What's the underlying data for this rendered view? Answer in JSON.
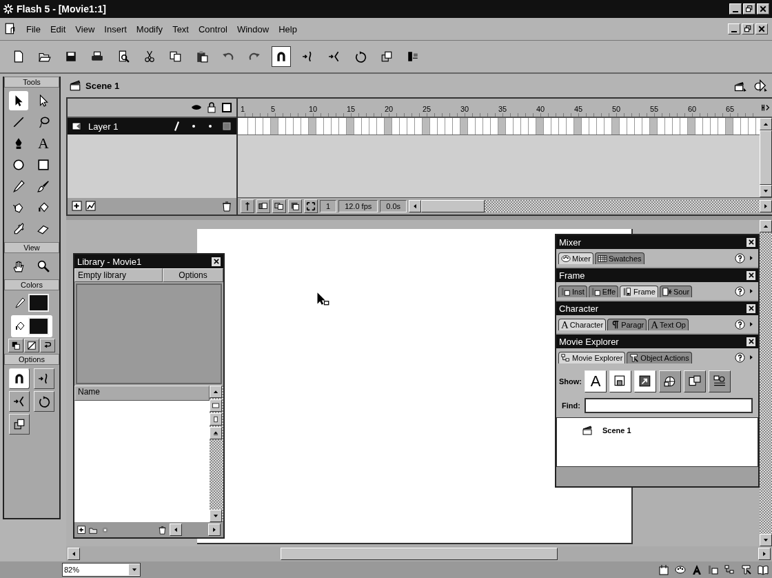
{
  "window": {
    "title": "Flash 5 - [Movie1:1]"
  },
  "menu": [
    "File",
    "Edit",
    "View",
    "Insert",
    "Modify",
    "Text",
    "Control",
    "Window",
    "Help"
  ],
  "toolbar": [
    {
      "kind": "new",
      "selected": false
    },
    {
      "kind": "open",
      "selected": false
    },
    {
      "kind": "save",
      "selected": false
    },
    {
      "kind": "print",
      "selected": false
    },
    {
      "kind": "preview",
      "selected": false
    },
    {
      "kind": "cut",
      "selected": false
    },
    {
      "kind": "copy",
      "selected": false
    },
    {
      "kind": "paste",
      "selected": false
    },
    {
      "kind": "undo",
      "selected": false
    },
    {
      "kind": "redo",
      "selected": false
    },
    {
      "kind": "snap",
      "selected": true
    },
    {
      "kind": "smooth",
      "selected": false
    },
    {
      "kind": "straighten",
      "selected": false
    },
    {
      "kind": "rotate",
      "selected": false
    },
    {
      "kind": "scale",
      "selected": false
    },
    {
      "kind": "align",
      "selected": false
    }
  ],
  "tools": {
    "title": "Tools",
    "items": [
      {
        "kind": "arrow",
        "selected": true
      },
      {
        "kind": "subselect",
        "selected": false
      },
      {
        "kind": "line",
        "selected": false
      },
      {
        "kind": "lasso",
        "selected": false
      },
      {
        "kind": "pen",
        "selected": false
      },
      {
        "kind": "text",
        "glyph": "A",
        "selected": false
      },
      {
        "kind": "oval",
        "selected": false
      },
      {
        "kind": "rect",
        "selected": false
      },
      {
        "kind": "pencil",
        "selected": false
      },
      {
        "kind": "brush",
        "selected": false
      },
      {
        "kind": "inkbottle",
        "selected": false
      },
      {
        "kind": "bucket",
        "selected": false
      },
      {
        "kind": "dropper",
        "selected": false
      },
      {
        "kind": "eraser",
        "selected": false
      }
    ]
  },
  "view": {
    "title": "View",
    "items": [
      {
        "kind": "hand",
        "selected": false
      },
      {
        "kind": "zoom",
        "selected": false
      }
    ]
  },
  "colors": {
    "title": "Colors",
    "wells": [
      {
        "kind": "stroke",
        "selected": false
      },
      {
        "kind": "fill",
        "selected": true
      }
    ],
    "buttons": [
      {
        "kind": "defaults"
      },
      {
        "kind": "nocolor"
      },
      {
        "kind": "swap"
      }
    ]
  },
  "options": {
    "title": "Options",
    "items": [
      {
        "kind": "snap",
        "selected": true
      },
      {
        "kind": "smooth",
        "selected": false
      },
      {
        "kind": "straighten",
        "selected": false
      },
      {
        "kind": "rotate",
        "selected": false
      },
      {
        "kind": "scale",
        "selected": false
      }
    ]
  },
  "timeline": {
    "scene": "Scene 1",
    "layers": [
      {
        "name": "Layer 1",
        "selected": true
      }
    ],
    "ruler": [
      "1",
      "5",
      "10",
      "15",
      "20",
      "25",
      "30",
      "35",
      "40",
      "45",
      "50",
      "55",
      "60",
      "65"
    ],
    "current_frame": "1",
    "frame_rate": "12.0 fps",
    "elapsed": "0.0s"
  },
  "library": {
    "title": "Library - Movie1",
    "status": "Empty library",
    "options": "Options",
    "column": "Name"
  },
  "panels": [
    {
      "title": "Mixer",
      "tabs": [
        {
          "label": "Mixer",
          "kind": "palette",
          "selected": true
        },
        {
          "label": "Swatches",
          "kind": "grid",
          "selected": false
        }
      ]
    },
    {
      "title": "Frame",
      "tabs": [
        {
          "label": "Inst",
          "kind": "instance",
          "selected": false
        },
        {
          "label": "Effe",
          "kind": "instance",
          "selected": false
        },
        {
          "label": "Frame",
          "kind": "frame",
          "selected": true
        },
        {
          "label": "Sour",
          "kind": "sound",
          "selected": false
        }
      ]
    },
    {
      "title": "Character",
      "tabs": [
        {
          "label": "Character",
          "kind": "letter",
          "glyph": "A",
          "selected": true
        },
        {
          "label": "Paragr",
          "kind": "paragraph",
          "selected": false
        },
        {
          "label": "Text Op",
          "kind": "letter",
          "glyph": "A",
          "selected": false
        }
      ]
    },
    {
      "title": "Movie Explorer",
      "tabs": [
        {
          "label": "Movie Explorer",
          "kind": "explorer",
          "selected": true
        },
        {
          "label": "Object Actions",
          "kind": "actions",
          "selected": false
        }
      ],
      "show_label": "Show:",
      "filters": [
        {
          "kind": "text",
          "glyph": "A",
          "selected": true
        },
        {
          "kind": "button",
          "selected": true
        },
        {
          "kind": "action",
          "selected": true
        },
        {
          "kind": "video",
          "selected": false
        },
        {
          "kind": "frames",
          "selected": false
        },
        {
          "kind": "customize",
          "selected": false
        }
      ],
      "find_label": "Find:",
      "tree": [
        {
          "name": "Scene 1"
        }
      ]
    }
  ],
  "status_bar": {
    "zoom": "82%"
  }
}
